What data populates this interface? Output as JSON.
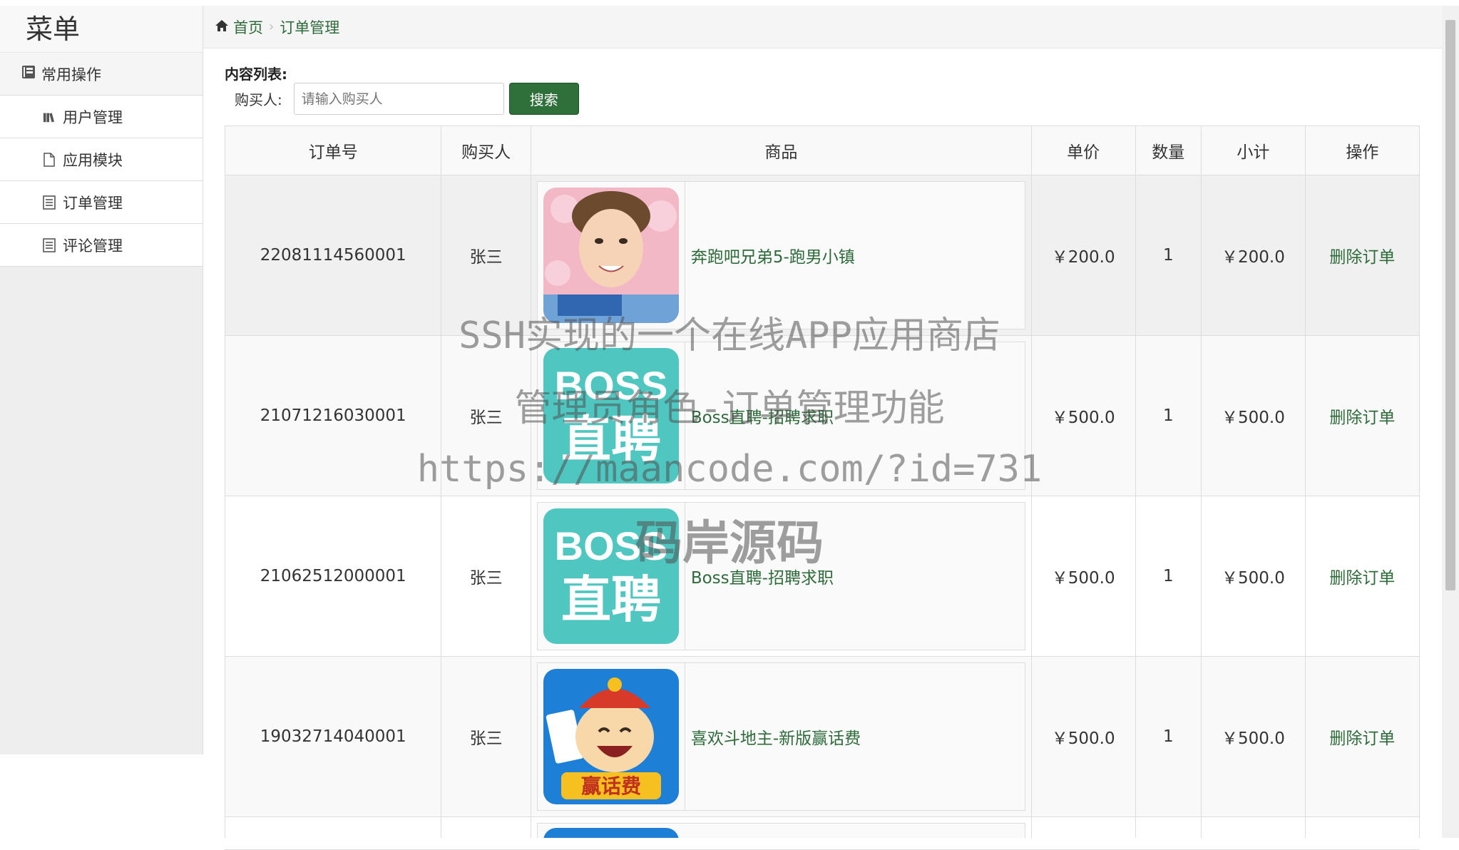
{
  "sidebar": {
    "title": "菜单",
    "group_label": "常用操作",
    "items": [
      {
        "label": "用户管理",
        "icon": "books-icon"
      },
      {
        "label": "应用模块",
        "icon": "file-icon"
      },
      {
        "label": "订单管理",
        "icon": "list-icon"
      },
      {
        "label": "评论管理",
        "icon": "list-icon"
      }
    ]
  },
  "breadcrumb": {
    "home": "首页",
    "current": "订单管理"
  },
  "content": {
    "section_label": "内容列表:",
    "search": {
      "label": "购买人:",
      "placeholder": "请输入购买人",
      "button": "搜索"
    }
  },
  "table": {
    "headers": [
      "订单号",
      "购买人",
      "商品",
      "单价",
      "数量",
      "小计",
      "操作"
    ],
    "rows": [
      {
        "order_no": "22081114560001",
        "buyer": "张三",
        "product": "奔跑吧兄弟5-跑男小镇",
        "price": "￥200.0",
        "qty": "1",
        "subtotal": "￥200.0",
        "action": "删除订单"
      },
      {
        "order_no": "21071216030001",
        "buyer": "张三",
        "product": "Boss直聘-招聘求职",
        "price": "￥500.0",
        "qty": "1",
        "subtotal": "￥500.0",
        "action": "删除订单"
      },
      {
        "order_no": "21062512000001",
        "buyer": "张三",
        "product": "Boss直聘-招聘求职",
        "price": "￥500.0",
        "qty": "1",
        "subtotal": "￥500.0",
        "action": "删除订单"
      },
      {
        "order_no": "19032714040001",
        "buyer": "张三",
        "product": "喜欢斗地主-新版赢话费",
        "price": "￥500.0",
        "qty": "1",
        "subtotal": "￥500.0",
        "action": "删除订单"
      }
    ]
  },
  "watermark": {
    "line1": "SSH实现的一个在线APP应用商店",
    "line2": "管理员角色-订单管理功能",
    "line3": "https://maancode.com/?id=731",
    "line4": "码岸源码"
  },
  "thumb_texts": {
    "boss_top": "BOSS",
    "boss_bottom": "直聘",
    "game_banner": "赢话费"
  },
  "colors": {
    "accent": "#2f6f3a",
    "link": "#2e6b3a",
    "boss_teal": "#4fc6c0"
  }
}
